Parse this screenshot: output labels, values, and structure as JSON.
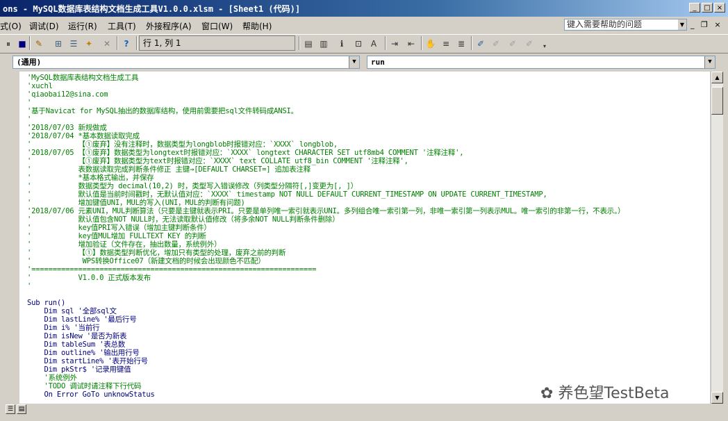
{
  "window": {
    "title": "ons - MySQL数据库表结构文档生成工具V1.0.0.xlsm - [Sheet1 (代码)]",
    "min_btn": "_",
    "max_btn": "□",
    "close_btn": "×"
  },
  "menu": {
    "items": [
      "式(O)",
      "调试(D)",
      "运行(R)",
      "工具(T)",
      "外接程序(A)",
      "窗口(W)",
      "帮助(H)"
    ]
  },
  "help_box": {
    "placeholder": "键入需要帮助的问题"
  },
  "mdi": {
    "min": "_",
    "restore": "❐",
    "close": "×"
  },
  "toolbar": {
    "position": "行 1, 列 1"
  },
  "code_window": {
    "object_combo": "(通用)",
    "proc_combo": "run"
  },
  "code_lines": [
    {
      "t": "'MySQL数据库表结构文档生成工具",
      "c": "cm"
    },
    {
      "t": "'xuchl",
      "c": "cm"
    },
    {
      "t": "'qiaobai12@sina.com",
      "c": "cm"
    },
    {
      "t": "'",
      "c": "cm"
    },
    {
      "t": "'基于Navicat for MySQL抽出的数据库结构，使用前需要把sql文件转码成ANSI。",
      "c": "cm"
    },
    {
      "t": "'",
      "c": "cm"
    },
    {
      "t": "'2018/07/03 新规做成",
      "c": "cm"
    },
    {
      "t": "'2018/07/04 *基本数据读取完成",
      "c": "cm"
    },
    {
      "t": "'           【①废弃】没有注释时，数据类型为longblob时报错对应：`XXXX` longblob,",
      "c": "cm"
    },
    {
      "t": "'2018/07/05 【①废弃】数据类型为longtext时报错对应：`XXXX` longtext CHARACTER SET utf8mb4 COMMENT '注释注释',",
      "c": "cm"
    },
    {
      "t": "'           【①废弃】数据类型为text时报错对应：`XXXX` text COLLATE utf8_bin COMMENT '注释注释',",
      "c": "cm"
    },
    {
      "t": "'           表数据读取完成判断条件修正 主键→[DEFAULT CHARSET=] 追加表注释",
      "c": "cm"
    },
    {
      "t": "'           *基本格式输出，并保存",
      "c": "cm"
    },
    {
      "t": "'           数据类型为 decimal(10,2) 时，类型写入错误修改（列类型分隔符[,]变更为[, ]）",
      "c": "cm"
    },
    {
      "t": "'           默认值是当前时间戳时，无默认值对应：`XXXX` timestamp NOT NULL DEFAULT CURRENT_TIMESTAMP ON UPDATE CURRENT_TIMESTAMP,",
      "c": "cm"
    },
    {
      "t": "'           增加键值UNI，MUL的写入(UNI，MUL的判断有问题)",
      "c": "cm"
    },
    {
      "t": "'2018/07/06 元素UNI，MUL判断算法（只要是主键就表示PRI。只要是单列唯一索引就表示UNI。多列组合唯一索引第一列，非唯一索引第一列表示MUL。唯一索引的非第一行，不表示。）",
      "c": "cm"
    },
    {
      "t": "'           默认值包含NOT NULL时，无法读取默认值修改（将多余NOT NULL判断条件删除）",
      "c": "cm"
    },
    {
      "t": "'           key值PRI写入错误（增加主键判断条件）",
      "c": "cm"
    },
    {
      "t": "'           key值MUL增加 FULLTEXT KEY 的判断",
      "c": "cm"
    },
    {
      "t": "'           增加验证（文件存在，抽出数量，系统例外）",
      "c": "cm"
    },
    {
      "t": "'           【①】数据类型判断优化，增加只有类型的处理，废弃之前的判断",
      "c": "cm"
    },
    {
      "t": "'            WPS转换Office07（新建文档的时候会出现颜色不匹配）",
      "c": "cm"
    },
    {
      "t": "'===================================================================",
      "c": "cm"
    },
    {
      "t": "'           V1.0.0 正式版本发布",
      "c": "cm"
    },
    {
      "t": "'",
      "c": "cm"
    },
    {
      "t": "",
      "c": "kw"
    },
    {
      "t": "Sub run()",
      "c": "kw"
    },
    {
      "t": "    Dim sql '全部sql文",
      "c": "kw"
    },
    {
      "t": "    Dim lastLine% '最后行号",
      "c": "kw"
    },
    {
      "t": "    Dim i% '当前行",
      "c": "kw"
    },
    {
      "t": "    Dim isNew '是否为新表",
      "c": "kw"
    },
    {
      "t": "    Dim tableSum '表总数",
      "c": "kw"
    },
    {
      "t": "    Dim outline% '输出用行号",
      "c": "kw"
    },
    {
      "t": "    Dim startLine% '表开始行号",
      "c": "kw"
    },
    {
      "t": "    Dim pkStr$ '记录用键值",
      "c": "kw"
    },
    {
      "t": "    '系统例外",
      "c": "cm"
    },
    {
      "t": "    'TODO 调试时请注释下行代码",
      "c": "cm"
    },
    {
      "t": "    On Error GoTo unknowStatus",
      "c": "kw"
    }
  ],
  "watermark": "养色望TestBeta"
}
